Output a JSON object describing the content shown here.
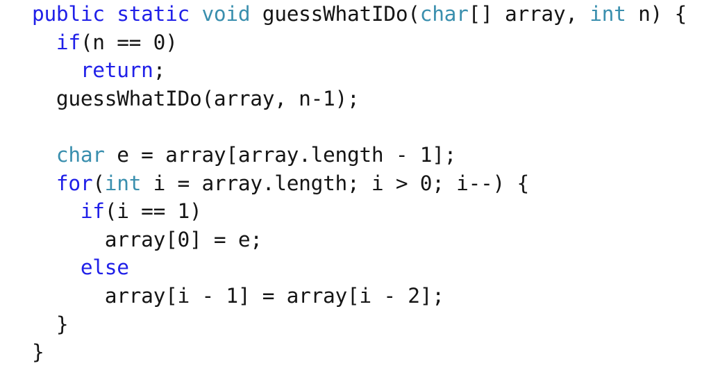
{
  "document": {
    "kind": "source-code-listing",
    "language": "Java",
    "background_color": "#ffffff",
    "colors": {
      "keyword": "#2020e8",
      "type": "#3a8fae",
      "plain": "#151515",
      "background": "#ffffff"
    },
    "method_name": "guessWhatIDo"
  },
  "code": {
    "lines": [
      {
        "index": 0,
        "indent": "",
        "text": "public static void guessWhatIDo(char[] array, int n) {",
        "tokens": [
          {
            "t": "public",
            "k": "kw"
          },
          {
            "t": " ",
            "k": "plain"
          },
          {
            "t": "static",
            "k": "kw"
          },
          {
            "t": " ",
            "k": "plain"
          },
          {
            "t": "void",
            "k": "type"
          },
          {
            "t": " guessWhatIDo(",
            "k": "plain"
          },
          {
            "t": "char",
            "k": "type"
          },
          {
            "t": "[] array, ",
            "k": "plain"
          },
          {
            "t": "int",
            "k": "type"
          },
          {
            "t": " n) {",
            "k": "plain"
          }
        ]
      },
      {
        "index": 1,
        "indent": "  ",
        "text": "  if(n == 0)",
        "tokens": [
          {
            "t": "  ",
            "k": "plain"
          },
          {
            "t": "if",
            "k": "kw"
          },
          {
            "t": "(n == 0)",
            "k": "plain"
          }
        ]
      },
      {
        "index": 2,
        "indent": "    ",
        "text": "    return;",
        "tokens": [
          {
            "t": "    ",
            "k": "plain"
          },
          {
            "t": "return",
            "k": "kw"
          },
          {
            "t": ";",
            "k": "plain"
          }
        ]
      },
      {
        "index": 3,
        "indent": "  ",
        "text": "  guessWhatIDo(array, n-1);",
        "tokens": [
          {
            "t": "  guessWhatIDo(array, n-1);",
            "k": "plain"
          }
        ]
      },
      {
        "index": 4,
        "indent": "",
        "text": "",
        "tokens": []
      },
      {
        "index": 5,
        "indent": "  ",
        "text": "  char e = array[array.length - 1];",
        "tokens": [
          {
            "t": "  ",
            "k": "plain"
          },
          {
            "t": "char",
            "k": "type"
          },
          {
            "t": " e = array[array.length - 1];",
            "k": "plain"
          }
        ]
      },
      {
        "index": 6,
        "indent": "  ",
        "text": "  for(int i = array.length; i > 0; i--) {",
        "tokens": [
          {
            "t": "  ",
            "k": "plain"
          },
          {
            "t": "for",
            "k": "kw"
          },
          {
            "t": "(",
            "k": "plain"
          },
          {
            "t": "int",
            "k": "type"
          },
          {
            "t": " i = array.length; i > 0; i--) {",
            "k": "plain"
          }
        ]
      },
      {
        "index": 7,
        "indent": "    ",
        "text": "    if(i == 1)",
        "tokens": [
          {
            "t": "    ",
            "k": "plain"
          },
          {
            "t": "if",
            "k": "kw"
          },
          {
            "t": "(i == 1)",
            "k": "plain"
          }
        ]
      },
      {
        "index": 8,
        "indent": "      ",
        "text": "      array[0] = e;",
        "tokens": [
          {
            "t": "      array[0] = e;",
            "k": "plain"
          }
        ]
      },
      {
        "index": 9,
        "indent": "    ",
        "text": "    else",
        "tokens": [
          {
            "t": "    ",
            "k": "plain"
          },
          {
            "t": "else",
            "k": "kw"
          }
        ]
      },
      {
        "index": 10,
        "indent": "      ",
        "text": "      array[i - 1] = array[i - 2];",
        "tokens": [
          {
            "t": "      array[i - 1] = array[i - 2];",
            "k": "plain"
          }
        ]
      },
      {
        "index": 11,
        "indent": "  ",
        "text": "  }",
        "tokens": [
          {
            "t": "  }",
            "k": "plain"
          }
        ]
      },
      {
        "index": 12,
        "indent": "",
        "text": "}",
        "tokens": [
          {
            "t": "}",
            "k": "plain"
          }
        ]
      }
    ]
  }
}
